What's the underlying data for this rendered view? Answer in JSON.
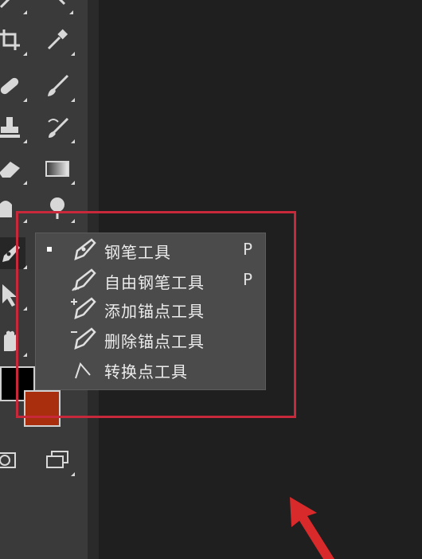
{
  "pen_tool_menu": {
    "items": [
      {
        "label": "钢笔工具",
        "shortcut": "P",
        "checked": true,
        "icon": "pen-icon"
      },
      {
        "label": "自由钢笔工具",
        "shortcut": "P",
        "checked": false,
        "icon": "freeform-pen-icon"
      },
      {
        "label": "添加锚点工具",
        "shortcut": "",
        "checked": false,
        "icon": "add-anchor-point-icon"
      },
      {
        "label": "删除锚点工具",
        "shortcut": "",
        "checked": false,
        "icon": "delete-anchor-point-icon"
      },
      {
        "label": "转换点工具",
        "shortcut": "",
        "checked": false,
        "icon": "convert-point-icon"
      }
    ]
  },
  "toolbar": {
    "tools": [
      {
        "icon": "magic-wand-icon"
      },
      {
        "icon": "crop-icon"
      },
      {
        "icon": "eyedropper-icon"
      },
      {
        "icon": "healing-brush-icon"
      },
      {
        "icon": "brush-icon"
      },
      {
        "icon": "clone-stamp-icon"
      },
      {
        "icon": "history-brush-icon"
      },
      {
        "icon": "eraser-icon"
      },
      {
        "icon": "gradient-icon"
      },
      {
        "icon": "blur-icon"
      },
      {
        "icon": "dodge-icon"
      },
      {
        "icon": "pen-icon"
      },
      {
        "icon": "path-selection-icon"
      },
      {
        "icon": "hand-icon"
      },
      {
        "icon": "quick-mask-icon"
      },
      {
        "icon": "screen-mode-icon"
      }
    ]
  },
  "colors": {
    "foreground": "#000000",
    "background": "#a82e0e",
    "annotation": "#c8293a"
  }
}
